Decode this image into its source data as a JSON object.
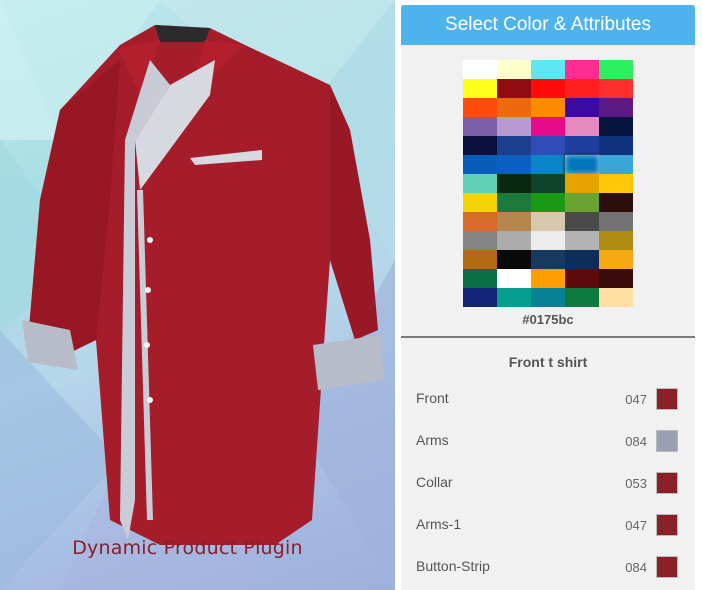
{
  "product_image": {
    "title": "Dynamic Product Plugin"
  },
  "panel": {
    "title": "Select Color & Attributes",
    "selected_hex": "#0175bc",
    "palette": [
      "#ffffff",
      "#ffffcc",
      "#5ee6f2",
      "#ff2d91",
      "#2cf05e",
      "#ffff1a",
      "#8e0c12",
      "#ff0d0d",
      "#ff2020",
      "#ff2f2f",
      "#ff4b0d",
      "#ec6a0c",
      "#ff8c00",
      "#3d0aa1",
      "#5b1a86",
      "#7c5fa6",
      "#b89ad1",
      "#e70a8a",
      "#e58ac0",
      "#06163f",
      "#0b0f3d",
      "#1b3f8c",
      "#2f4cb7",
      "#1f3f9c",
      "#0e327e",
      "#0b5bb8",
      "#0a5fc1",
      "#0a86c8",
      "#0175bc",
      "#3aa5d8",
      "#5ed1b4",
      "#0a2a0f",
      "#10432b",
      "#e6a400",
      "#ffc708",
      "#f3d40a",
      "#1c7a3c",
      "#1a9a14",
      "#6aa332",
      "#2c0f0a",
      "#d56a29",
      "#b5874e",
      "#d6c7ad",
      "#4a4a4a",
      "#727272",
      "#838383",
      "#acacac",
      "#ececec",
      "#b3b3b3",
      "#b08b12",
      "#b46a11",
      "#0a0a0a",
      "#163a5f",
      "#0e2c5a",
      "#f6a912",
      "#0a6d46",
      "#ffffff",
      "#ff9e00",
      "#5c0a0a",
      "#3b0a0a",
      "#132378",
      "#069e8e",
      "#078193",
      "#0c7a3e",
      "#ffe0a4"
    ],
    "section_title": "Front t shirt",
    "attributes": [
      {
        "label": "Front",
        "code": "047",
        "color": "#8b2128"
      },
      {
        "label": "Arms",
        "code": "084",
        "color": "#9aa0b2"
      },
      {
        "label": "Collar",
        "code": "053",
        "color": "#8b2128"
      },
      {
        "label": "Arms-1",
        "code": "047",
        "color": "#8b2128"
      },
      {
        "label": "Button-Strip",
        "code": "084",
        "color": "#8b2128"
      }
    ]
  }
}
